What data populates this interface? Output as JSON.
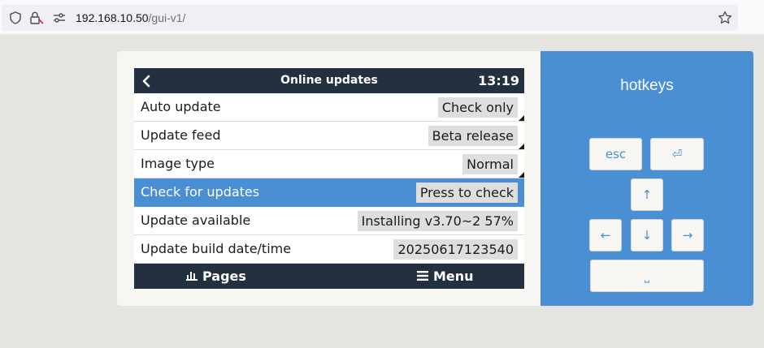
{
  "browser": {
    "url_host": "192.168.10.50",
    "url_path": "/gui-v1/"
  },
  "device": {
    "title": "Online updates",
    "time": "13:19",
    "rows": [
      {
        "label": "Auto update",
        "value": "Check only"
      },
      {
        "label": "Update feed",
        "value": "Beta release"
      },
      {
        "label": "Image type",
        "value": "Normal"
      },
      {
        "label": "Check for updates",
        "value": "Press to check"
      },
      {
        "label": "Update available",
        "value": "Installing v3.70~2 57%"
      },
      {
        "label": "Update build date/time",
        "value": "20250617123540"
      }
    ],
    "pages_label": "Pages",
    "menu_label": "Menu"
  },
  "hotkeys": {
    "title": "hotkeys",
    "esc_label": "esc",
    "enter_symbol": "⏎",
    "up_symbol": "↑",
    "left_symbol": "←",
    "down_symbol": "↓",
    "right_symbol": "→",
    "space_symbol": "⎵"
  },
  "colors": {
    "accent": "#4a8ed4",
    "header": "#22303f",
    "value_bg": "#dedede"
  }
}
